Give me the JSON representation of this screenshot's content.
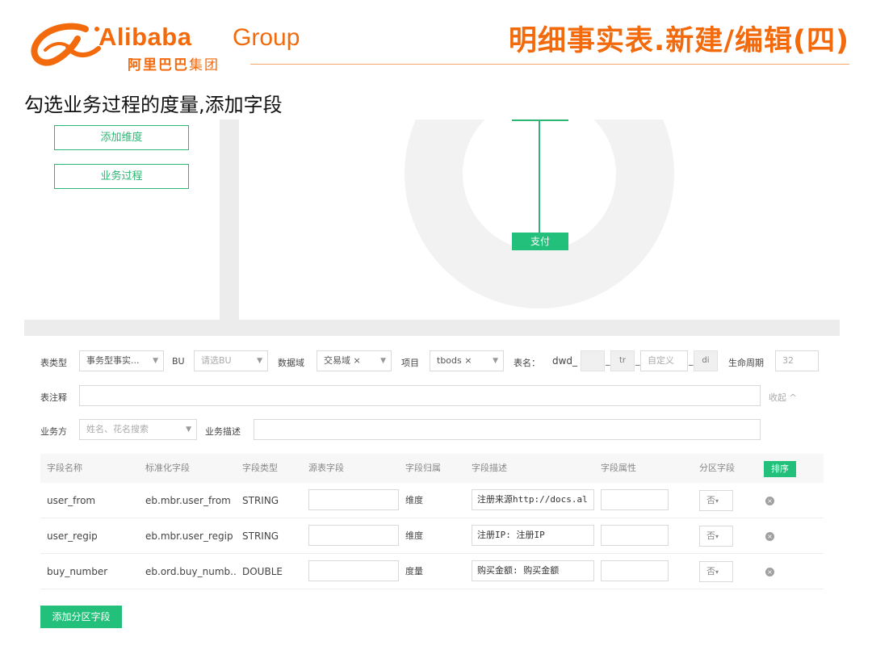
{
  "header": {
    "logo_word": "Alibaba",
    "logo_group": "Group",
    "logo_cn_bold": "阿里巴巴",
    "logo_cn_light": "集团",
    "title": "明细事实表.新建/编辑(四)",
    "subtitle": "勾选业务过程的度量,添加字段",
    "brand_color": "#f26a0c"
  },
  "canvas": {
    "add_dimension_label": "添加维度",
    "business_process_label": "业务过程",
    "pay_node_label": "支付",
    "accent_color": "#22c07a"
  },
  "form": {
    "table_type_label": "表类型",
    "table_type_value": "事务型事实...",
    "bu_label": "BU",
    "bu_placeholder": "请选BU",
    "data_domain_label": "数据域",
    "data_domain_value": "交易域 ×",
    "project_label": "项目",
    "project_value": "tbods ×",
    "table_name_label": "表名：",
    "table_name_prefix": "dwd_",
    "table_name_seg_tr": "tr",
    "table_name_custom_placeholder": "自定义",
    "table_name_seg_di": "di",
    "lifecycle_label": "生命周期",
    "lifecycle_value": "32",
    "table_comment_label": "表注释",
    "collapse_label": "收起 ^",
    "business_owner_label": "业务方",
    "business_owner_placeholder": "姓名、花名搜索",
    "business_desc_label": "业务描述"
  },
  "table": {
    "headers": [
      "字段名称",
      "标准化字段",
      "字段类型",
      "源表字段",
      "字段归属",
      "字段描述",
      "字段属性",
      "分区字段"
    ],
    "sort_label": "排序",
    "rows": [
      {
        "name": "user_from",
        "std": "eb.mbr.user_from",
        "type": "STRING",
        "source": "",
        "belong": "维度",
        "desc": "注册来源http://docs.al",
        "attr": "",
        "partition": "否"
      },
      {
        "name": "user_regip",
        "std": "eb.mbr.user_regip",
        "type": "STRING",
        "source": "",
        "belong": "维度",
        "desc": "注册IP: 注册IP",
        "attr": "",
        "partition": "否"
      },
      {
        "name": "buy_number",
        "std": "eb.ord.buy_numb..",
        "type": "DOUBLE",
        "source": "",
        "belong": "度量",
        "desc": "购买金额: 购买金额",
        "attr": "",
        "partition": "否"
      }
    ],
    "add_partition_label": "添加分区字段"
  }
}
